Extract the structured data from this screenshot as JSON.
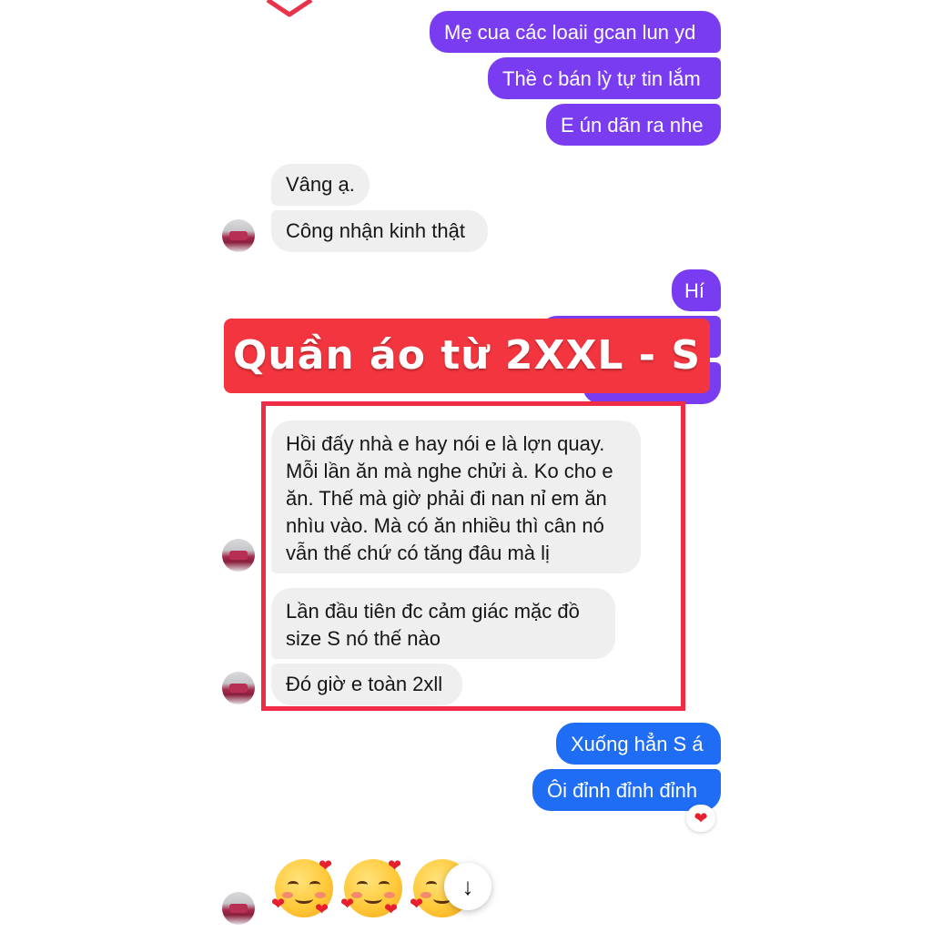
{
  "messages": {
    "m1": "Mẹ cua các loaii gcan lun yd",
    "m2": "Thề c bán lỳ tự tin lắm",
    "m3": "E ún dãn ra nhe",
    "m4": "Vâng ạ.",
    "m5": "Công nhận kinh thật",
    "m6": "Hí",
    "m7": "Hồi đấy nhà e hay nói e là lợn quay. Mỗi lần ăn mà nghe chửi à. Ko cho e ăn. Thế mà giờ phải đi nan nỉ em ăn nhìu vào. Mà có ăn nhiều thì cân nó vẫn thế chứ có tăng đâu mà lị",
    "m8": "Lần đầu tiên đc cảm giác mặc đồ size S nó thế nào",
    "m9": "Đó giờ e toàn 2xll",
    "m10": "Xuống hẳn S á",
    "m11": "Ôi đỉnh đỉnh đỉnh"
  },
  "banner": {
    "text": "Quần áo từ 2XXL - S"
  },
  "reaction": {
    "glyph": "❤"
  },
  "scroll": {
    "glyph": "↓"
  },
  "colors": {
    "outgoing_purple": "#7a3cf0",
    "outgoing_blue": "#1f6cf5",
    "incoming": "#efefef",
    "banner": "#f2353e",
    "frame": "#ee2c45"
  },
  "icons": [
    "heart-icon",
    "arrow-down-icon",
    "smiling-face-with-hearts-icon"
  ]
}
